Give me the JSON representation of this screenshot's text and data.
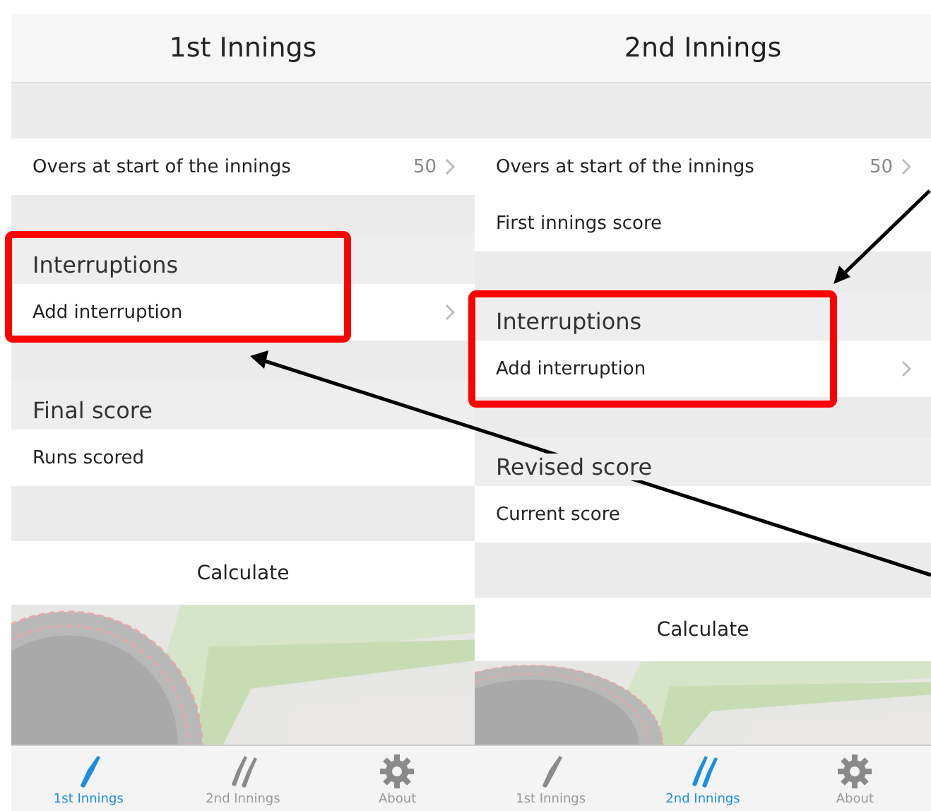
{
  "screens": [
    {
      "title": "1st Innings",
      "content": [
        {
          "kind": "spacer"
        },
        {
          "kind": "row",
          "label": "Overs at start of the innings",
          "value": "50",
          "chevron": true
        },
        {
          "kind": "gap"
        },
        {
          "kind": "header",
          "label": "Interruptions"
        },
        {
          "kind": "row",
          "label": "Add interruption",
          "chevron": true
        },
        {
          "kind": "gap"
        },
        {
          "kind": "header",
          "label": "Final score"
        },
        {
          "kind": "row",
          "label": "Runs scored",
          "chevron": false
        },
        {
          "kind": "spacer"
        },
        {
          "kind": "button",
          "label": "Calculate"
        },
        {
          "kind": "picture"
        }
      ],
      "tabs": [
        {
          "label": "1st Innings",
          "selected": true
        },
        {
          "label": "2nd Innings",
          "selected": false
        },
        {
          "label": "About",
          "selected": false
        }
      ]
    },
    {
      "title": "2nd Innings",
      "content": [
        {
          "kind": "spacer"
        },
        {
          "kind": "row",
          "label": "Overs at start of the innings",
          "value": "50",
          "chevron": true
        },
        {
          "kind": "row",
          "label": "First innings score",
          "chevron": false
        },
        {
          "kind": "gap"
        },
        {
          "kind": "header",
          "label": "Interruptions"
        },
        {
          "kind": "row",
          "label": "Add interruption",
          "chevron": true
        },
        {
          "kind": "gap"
        },
        {
          "kind": "header",
          "label": "Revised score"
        },
        {
          "kind": "row",
          "label": "Current score",
          "chevron": false
        },
        {
          "kind": "spacer"
        },
        {
          "kind": "button",
          "label": "Calculate"
        },
        {
          "kind": "picture"
        }
      ],
      "tabs": [
        {
          "label": "1st Innings",
          "selected": false
        },
        {
          "label": "2nd Innings",
          "selected": true
        },
        {
          "label": "About",
          "selected": false
        }
      ]
    }
  ]
}
